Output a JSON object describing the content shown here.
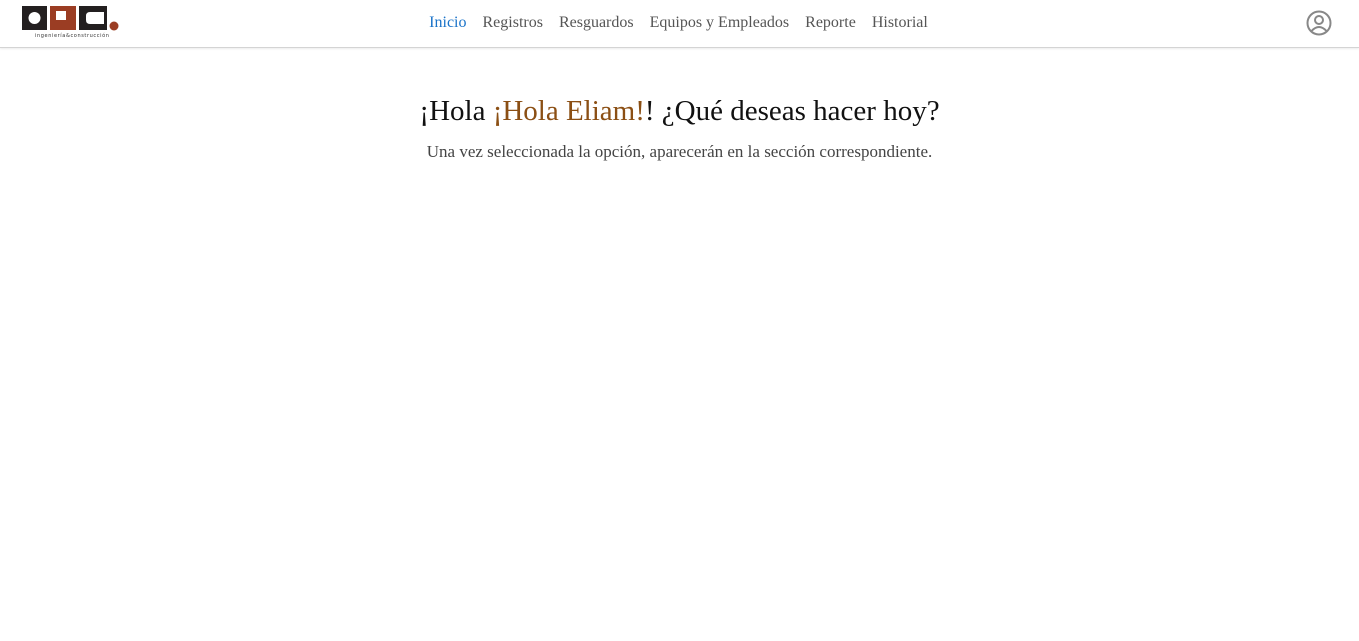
{
  "brand": {
    "logo_text": "OPC",
    "tagline": "ingeniería&construcción",
    "colors": {
      "dark": "#231f20",
      "accent": "#9b3d23"
    }
  },
  "nav": {
    "items": [
      {
        "label": "Inicio",
        "active": true
      },
      {
        "label": "Registros",
        "active": false
      },
      {
        "label": "Resguardos",
        "active": false
      },
      {
        "label": "Equipos y Empleados",
        "active": false
      },
      {
        "label": "Reporte",
        "active": false
      },
      {
        "label": "Historial",
        "active": false
      }
    ],
    "active_color": "#1a73c9",
    "user_icon": "user-circle-icon"
  },
  "main": {
    "greeting_prefix": "¡Hola ",
    "greeting_name": "¡Hola Eliam!",
    "greeting_suffix": "! ¿Qué deseas hacer hoy?",
    "name_color": "#8b4f14",
    "subtitle": "Una vez seleccionada la opción, aparecerán en la sección correspondiente."
  }
}
